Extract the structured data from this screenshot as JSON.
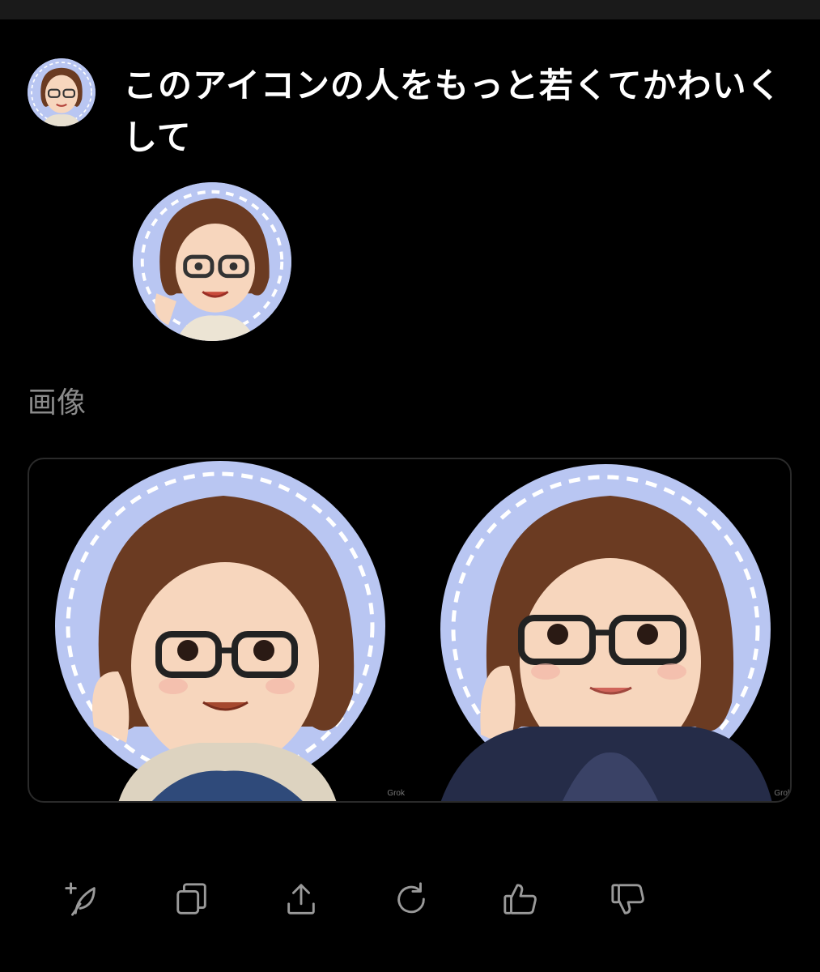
{
  "conversation": {
    "prompt_text": "このアイコンの人をもっと若くてかわいくして",
    "section_label": "画像"
  },
  "results": {
    "watermark": "Grok"
  },
  "actions": [
    {
      "icon": "new-image-icon"
    },
    {
      "icon": "copy-icon"
    },
    {
      "icon": "share-icon"
    },
    {
      "icon": "regenerate-icon"
    },
    {
      "icon": "thumbs-up-icon"
    },
    {
      "icon": "thumbs-down-icon"
    }
  ],
  "colors": {
    "background": "#000000",
    "text": "#ffffff",
    "muted": "#8a8a8a",
    "avatar_bg": "#b9c6f2",
    "hair": "#6b3b22",
    "skin": "#f7d6bd",
    "icon_gray": "#9a9a9a"
  }
}
